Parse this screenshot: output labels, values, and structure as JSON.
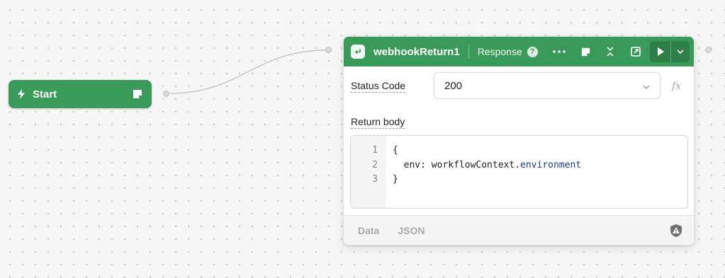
{
  "start_node": {
    "label": "Start",
    "icon": "bolt-icon",
    "note_icon": "sticky-note-icon"
  },
  "node": {
    "title": "webhookReturn1",
    "subtitle": "Response",
    "help": "?",
    "header_color": "#3a9a59",
    "run_color": "#2f7f49",
    "actions": [
      "more-icon",
      "sticky-note-icon",
      "collapse-icon",
      "open-external-icon",
      "run-icon",
      "chevron-down-icon"
    ]
  },
  "status_code": {
    "label": "Status Code",
    "value": "200",
    "fx": "fx"
  },
  "return_body": {
    "label": "Return body",
    "line_numbers": [
      "1",
      "2",
      "3"
    ],
    "lines": {
      "l1": "{",
      "l2_key": "  env: workflowContext.",
      "l2_prop": "environment",
      "l3": "}"
    }
  },
  "footer": {
    "tabs": [
      "Data",
      "JSON"
    ],
    "warning_icon": "warning-shield-icon"
  }
}
